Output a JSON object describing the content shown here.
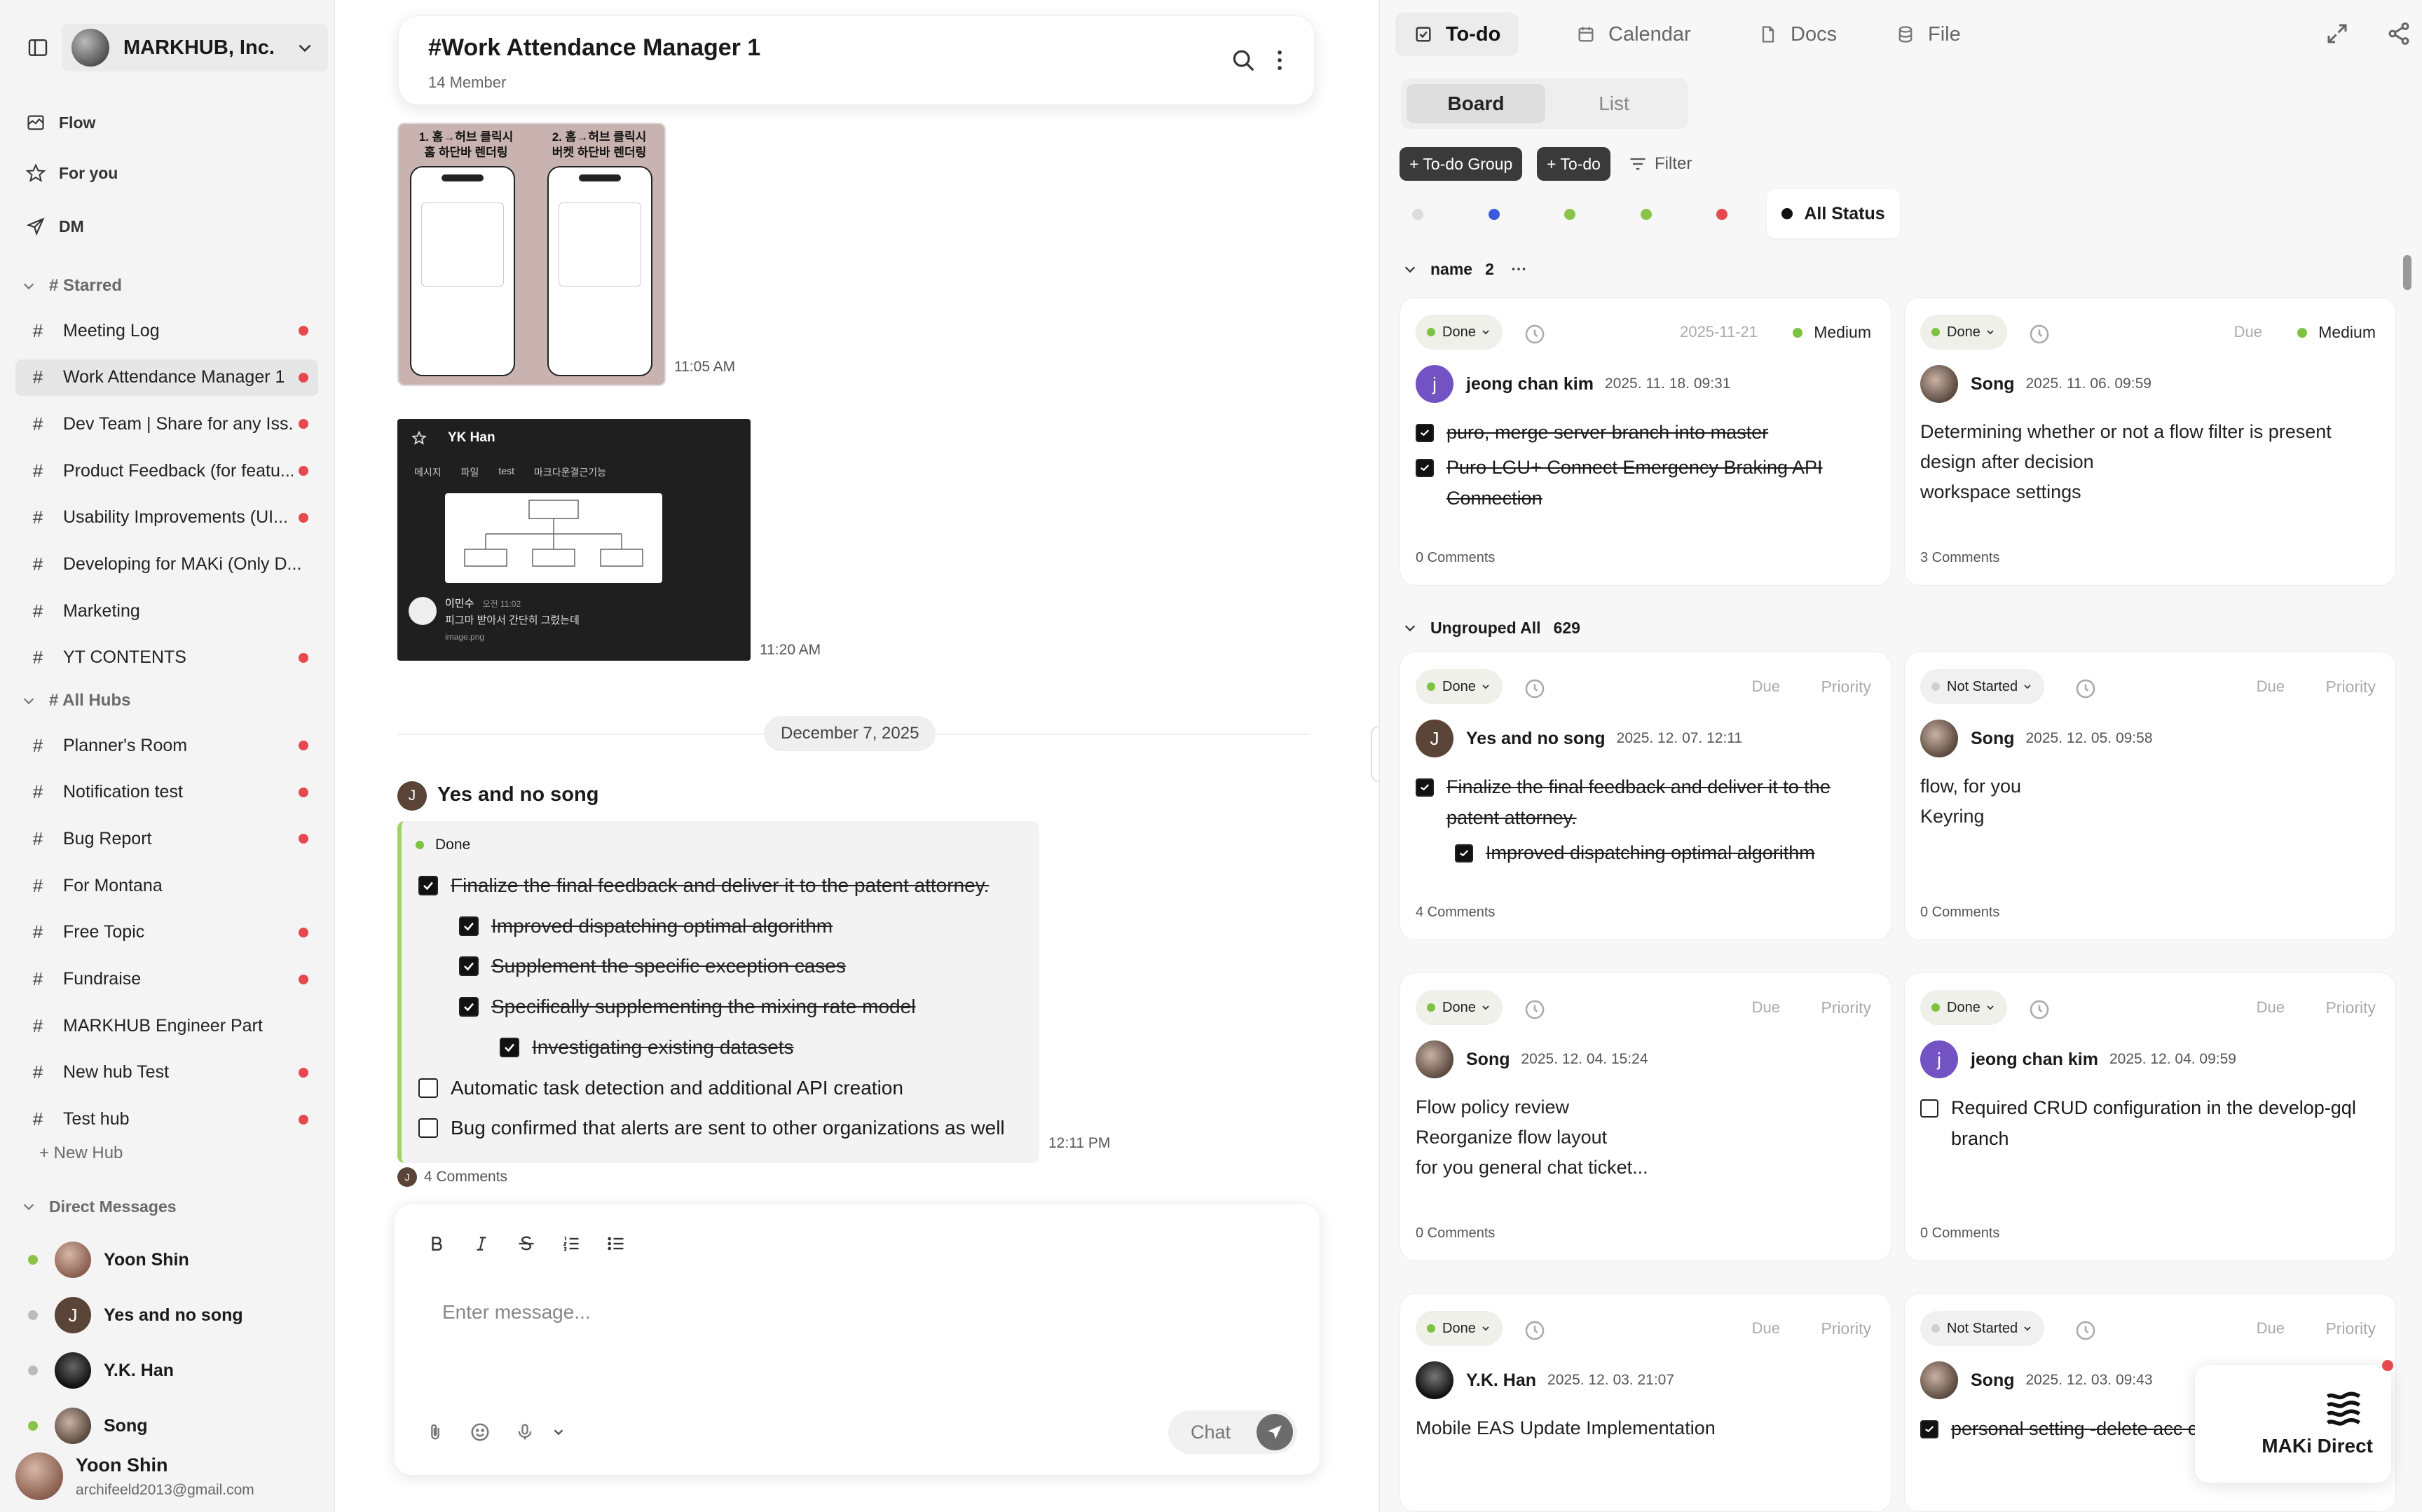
{
  "sidebar": {
    "org_name": "MARKHUB, Inc.",
    "nav": [
      {
        "label": "Flow",
        "icon": "flow-icon"
      },
      {
        "label": "For you",
        "icon": "star-icon"
      },
      {
        "label": "DM",
        "icon": "send-icon"
      }
    ],
    "starred_label": "# Starred",
    "starred": [
      {
        "label": "Meeting Log",
        "unread": true
      },
      {
        "label": "Work Attendance Manager 1",
        "unread": true,
        "active": true
      },
      {
        "label": "Dev Team | Share for any Iss...",
        "unread": true
      },
      {
        "label": "Product Feedback (for featu...",
        "unread": true
      },
      {
        "label": "Usability Improvements (UI...",
        "unread": true
      },
      {
        "label": "Developing for MAKi (Only D...",
        "unread": false
      },
      {
        "label": "Marketing",
        "unread": false
      },
      {
        "label": "YT CONTENTS",
        "unread": true
      }
    ],
    "hubs_label": "# All Hubs",
    "hubs": [
      {
        "label": "Planner's Room",
        "unread": true
      },
      {
        "label": "Notification test",
        "unread": true
      },
      {
        "label": "Bug Report",
        "unread": true
      },
      {
        "label": "For Montana",
        "unread": false
      },
      {
        "label": "Free Topic",
        "unread": true
      },
      {
        "label": "Fundraise",
        "unread": true
      },
      {
        "label": "MARKHUB Engineer Part",
        "unread": false
      },
      {
        "label": "New hub Test",
        "unread": true
      },
      {
        "label": "Test hub",
        "unread": true
      }
    ],
    "new_hub_label": "+ New Hub",
    "dm_label": "Direct Messages",
    "dms": [
      {
        "name": "Yoon Shin",
        "initial": "",
        "presence": "#8bc34a"
      },
      {
        "name": "Yes and no song",
        "initial": "J",
        "presence": "#bbbbbb"
      },
      {
        "name": "Y.K. Han",
        "initial": "",
        "presence": "#bbbbbb"
      },
      {
        "name": "Song",
        "initial": "",
        "presence": "#8bc34a"
      }
    ],
    "user": {
      "name": "Yoon Shin",
      "email": "archifeeld2013@gmail.com"
    }
  },
  "chat": {
    "title": "#Work Attendance Manager 1",
    "members": "14 Member",
    "image1": {
      "left_caption": "1. 홈→허브 클릭시\n홈 하단바 렌더링",
      "right_caption": "2. 홈→허브 클릭시\n버켓 하단바 렌더링",
      "time": "11:05 AM"
    },
    "image2": {
      "user": "YK Han",
      "tabs": [
        "메시지",
        "파일",
        "test",
        "마크다운결근기능"
      ],
      "reply_user": "이민수",
      "reply_time": "오전 11:02",
      "reply_text": "피그마 받아서 간단히 그렸는데",
      "attachment": "image.png",
      "time": "11:20 AM"
    },
    "date_divider": "December 7, 2025",
    "message": {
      "author": "Yes and no song",
      "author_initial": "J",
      "status": "Done",
      "items": [
        {
          "text": "Finalize the final feedback and deliver it to the patent attorney.",
          "checked": true,
          "level": 0
        },
        {
          "text": "Improved dispatching optimal algorithm",
          "checked": true,
          "level": 1
        },
        {
          "text": "Supplement the specific exception cases",
          "checked": true,
          "level": 1
        },
        {
          "text": "Specifically supplementing the mixing rate model",
          "checked": true,
          "level": 1
        },
        {
          "text": "Investigating existing datasets",
          "checked": true,
          "level": 2
        },
        {
          "text": "Automatic task detection and additional API creation",
          "checked": false,
          "level": 0
        },
        {
          "text": "Bug confirmed that alerts are sent to other organizations as well",
          "checked": false,
          "level": 0
        }
      ],
      "time": "12:11 PM",
      "comments": "4 Comments"
    },
    "composer": {
      "placeholder": "Enter message...",
      "send_label": "Chat"
    }
  },
  "panel": {
    "tabs": [
      {
        "label": "To-do",
        "icon": "todo-icon",
        "active": true
      },
      {
        "label": "Calendar",
        "icon": "calendar-icon"
      },
      {
        "label": "Docs",
        "icon": "docs-icon"
      },
      {
        "label": "File",
        "icon": "file-icon"
      }
    ],
    "views": [
      "Board",
      "List"
    ],
    "add_group": "+ To-do Group",
    "add_todo": "+ To-do",
    "filter": "Filter",
    "status_colors": [
      "#dcdcdc",
      "#3b5bdb",
      "#8bc34a",
      "#8bc34a",
      "#e5484d"
    ],
    "all_status": "All Status",
    "group1": {
      "name": "name",
      "count": "2"
    },
    "group2": {
      "name": "Ungrouped All",
      "count": "629"
    },
    "cards": [
      {
        "status": "Done",
        "due": "2025-11-21",
        "priority": "Medium",
        "author": "jeong chan kim",
        "initial": "j",
        "avatar": "#7353c4",
        "date": "2025. 11. 18. 09:31",
        "todos": [
          {
            "text": "puro, merge server branch into master",
            "checked": true
          },
          {
            "text": "Puro LGU+ Connect Emergency Braking API Connection",
            "checked": true
          }
        ],
        "text": [],
        "comments": "0 Comments"
      },
      {
        "status": "Done",
        "due": "Due",
        "priority": "Medium",
        "author": "Song",
        "initial": "",
        "avatar": "#6d5a4e",
        "date": "2025. 11. 06. 09:59",
        "todos": [],
        "text": [
          "Determining whether or not a flow filter is present",
          "design after decision",
          "workspace settings"
        ],
        "comments": "3 Comments"
      },
      {
        "status": "Done",
        "due": "Due",
        "priority": "Priority",
        "author": "Yes and no song",
        "initial": "J",
        "avatar": "#5a4337",
        "date": "2025. 12. 07. 12:11",
        "todos": [
          {
            "text": "Finalize the final feedback and deliver it to the patent attorney.",
            "checked": true
          },
          {
            "text": "Improved dispatching optimal algorithm",
            "checked": true,
            "indent": true
          }
        ],
        "text": [],
        "comments": "4 Comments"
      },
      {
        "status": "Not Started",
        "due": "Due",
        "priority": "Priority",
        "author": "Song",
        "initial": "",
        "avatar": "#6d5a4e",
        "date": "2025. 12. 05. 09:58",
        "todos": [],
        "text": [
          "flow, for you",
          "Keyring"
        ],
        "comments": "0 Comments"
      },
      {
        "status": "Done",
        "due": "Due",
        "priority": "Priority",
        "author": "Song",
        "initial": "",
        "avatar": "#6d5a4e",
        "date": "2025. 12. 04. 15:24",
        "todos": [],
        "text": [
          "Flow policy review",
          "Reorganize flow layout",
          "for you general chat ticket..."
        ],
        "comments": "0 Comments"
      },
      {
        "status": "Done",
        "due": "Due",
        "priority": "Priority",
        "author": "jeong chan kim",
        "initial": "j",
        "avatar": "#7353c4",
        "date": "2025. 12. 04. 09:59",
        "todos": [
          {
            "text": "Required CRUD configuration in the develop-gql branch",
            "checked": false
          }
        ],
        "text": [],
        "comments": "0 Comments"
      },
      {
        "status": "Done",
        "due": "Due",
        "priority": "Priority",
        "author": "Y.K. Han",
        "initial": "",
        "avatar": "#222222",
        "date": "2025. 12. 03. 21:07",
        "todos": [],
        "text": [
          "Mobile EAS Update Implementation"
        ],
        "comments": ""
      },
      {
        "status": "Not Started",
        "due": "Due",
        "priority": "Priority",
        "author": "Song",
        "initial": "",
        "avatar": "#6d5a4e",
        "date": "2025. 12. 03. 09:43",
        "todos": [
          {
            "text": "personal setting -delete acc chat UI (unknown)",
            "checked": true
          }
        ],
        "text": [],
        "comments": ""
      }
    ],
    "maki_label": "MAKi Direct"
  }
}
